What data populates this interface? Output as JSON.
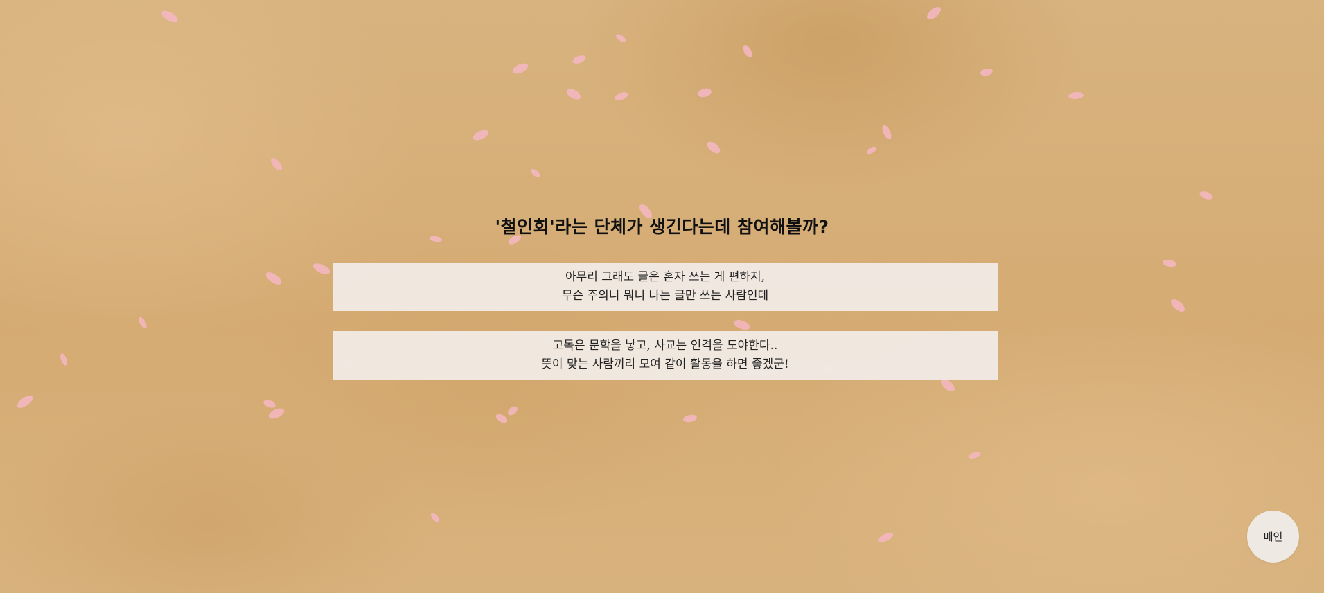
{
  "page": {
    "question": "'철인회'라는 단체가 생긴다는데 참여해볼까?",
    "cards": [
      {
        "line1": "아무리 그래도 글은 혼자 쓰는 게 편하지,",
        "line2": "무슨 주의니 뭐니 나는 글만 쓰는 사람인데"
      },
      {
        "line1": "고독은 문학을 낳고, 사교는 인격을 도야한다..",
        "line2": "뜻이 맞는 사람끼리 모여 같이 활동을 하면 좋겠군!"
      }
    ],
    "main_button_label": "메인"
  },
  "colors": {
    "background": "#d7b07b",
    "card": "#f0eae4",
    "petal": "#f6b8c4",
    "text": "#222222"
  },
  "icons": {
    "decoration": "cherry-blossom-petal"
  }
}
